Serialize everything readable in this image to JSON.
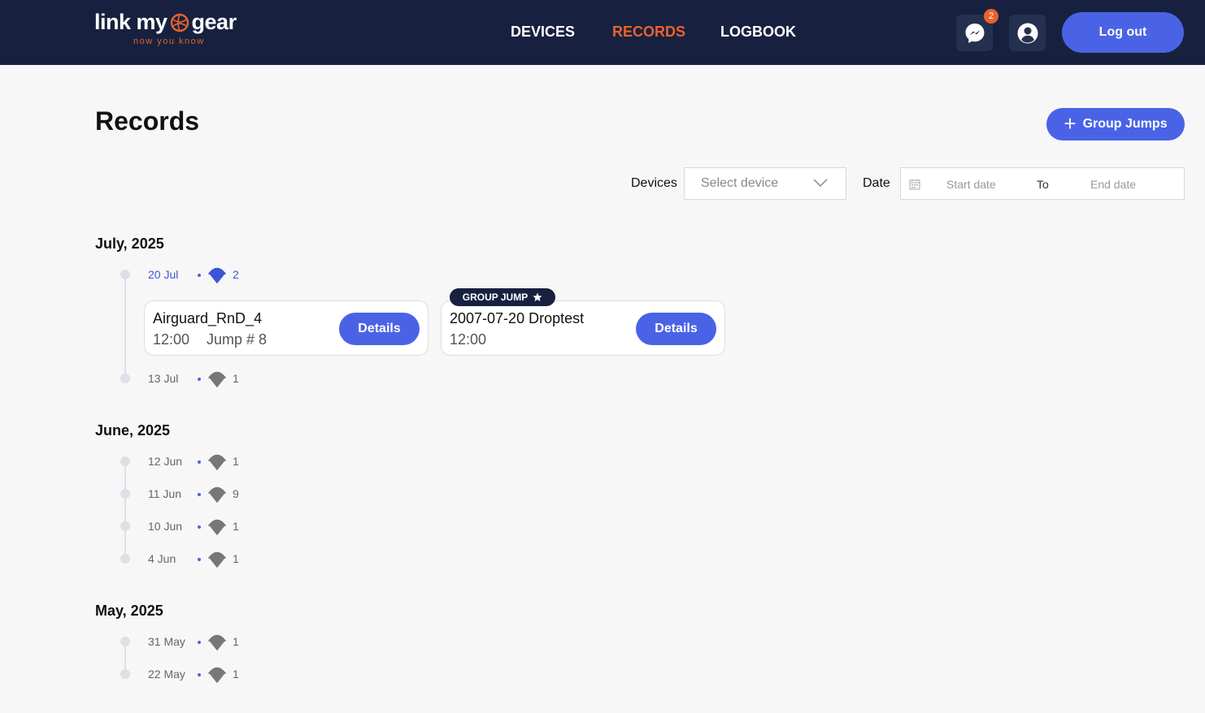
{
  "header": {
    "logo": {
      "main_a": "link my",
      "main_b": "gear",
      "tagline": "now you know"
    },
    "nav": [
      {
        "label": "DEVICES"
      },
      {
        "label": "RECORDS"
      },
      {
        "label": "LOGBOOK"
      }
    ],
    "messages_badge": "2",
    "logout_label": "Log out",
    "colors": {
      "bar": "#17213f",
      "accent": "#e9622d",
      "primary": "#4a63e6"
    }
  },
  "page": {
    "title": "Records",
    "group_jumps_label": "Group Jumps",
    "filters": {
      "devices_label": "Devices",
      "device_placeholder": "Select device",
      "date_label": "Date",
      "start_placeholder": "Start date",
      "to_label": "To",
      "end_placeholder": "End date"
    }
  },
  "months": [
    {
      "label": "July, 2025",
      "days": [
        {
          "date": "20 Jul",
          "count": "2"
        },
        {
          "date": "13 Jul",
          "count": "1"
        }
      ]
    },
    {
      "label": "June, 2025",
      "days": [
        {
          "date": "12 Jun",
          "count": "1"
        },
        {
          "date": "11 Jun",
          "count": "9"
        },
        {
          "date": "10 Jun",
          "count": "1"
        },
        {
          "date": "4 Jun",
          "count": "1"
        }
      ]
    },
    {
      "label": "May, 2025",
      "days": [
        {
          "date": "31 May",
          "count": "1"
        },
        {
          "date": "22 May",
          "count": "1"
        }
      ]
    }
  ],
  "jump_cards": [
    {
      "title": "Airguard_RnD_4",
      "time": "12:00",
      "jump": "Jump # 8",
      "details_label": "Details"
    },
    {
      "tag": "GROUP JUMP",
      "title": "2007-07-20 Droptest",
      "time": "12:00",
      "details_label": "Details"
    }
  ]
}
